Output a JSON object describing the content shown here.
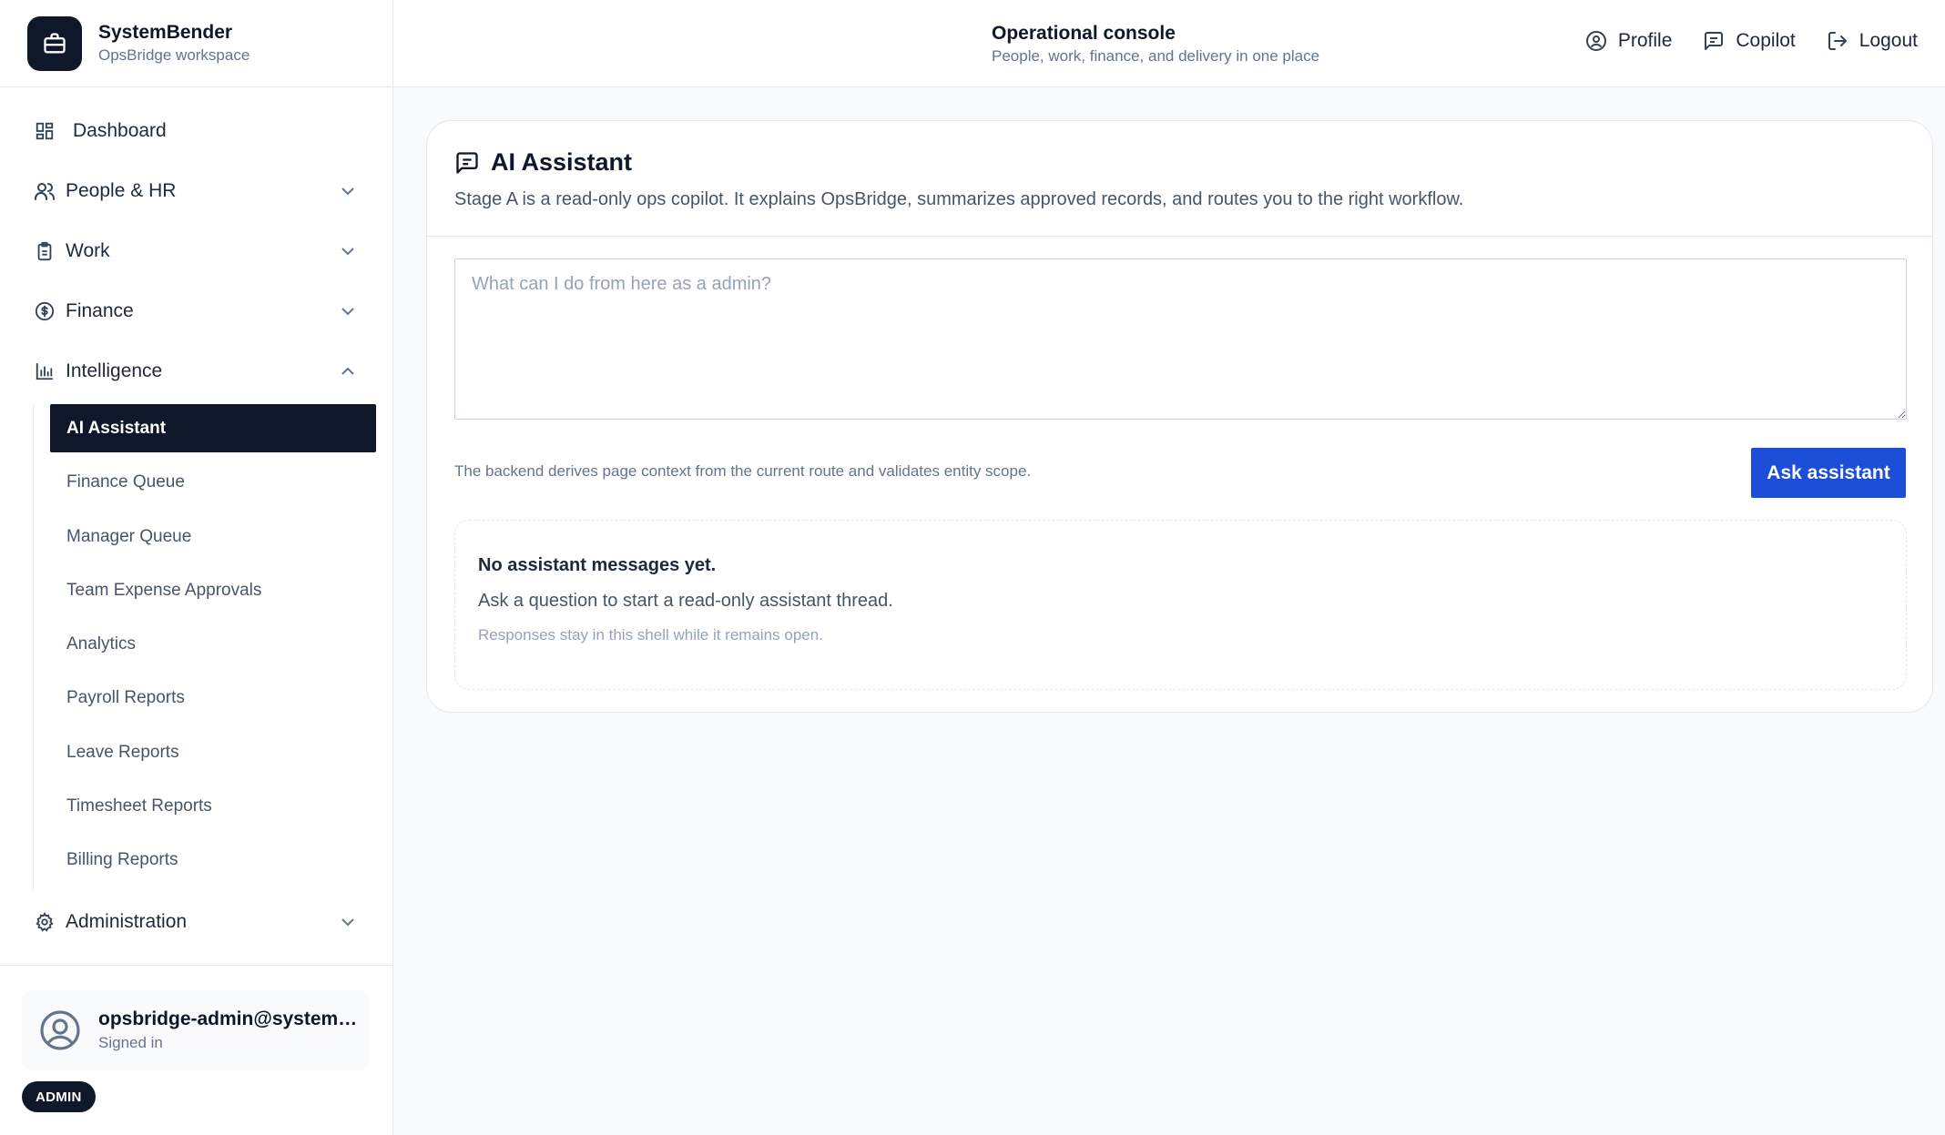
{
  "brand": {
    "name": "SystemBender",
    "workspace": "OpsBridge workspace"
  },
  "header": {
    "title": "Operational console",
    "subtitle": "People, work, finance, and delivery in one place",
    "actions": {
      "profile": "Profile",
      "copilot": "Copilot",
      "logout": "Logout"
    }
  },
  "sidebar": {
    "items": [
      {
        "label": "Dashboard",
        "icon": "grid-icon"
      },
      {
        "label": "People & HR",
        "icon": "users-icon",
        "expanded": false
      },
      {
        "label": "Work",
        "icon": "clipboard-icon",
        "expanded": false
      },
      {
        "label": "Finance",
        "icon": "dollar-circle-icon",
        "expanded": false
      },
      {
        "label": "Intelligence",
        "icon": "bar-chart-icon",
        "expanded": true
      },
      {
        "label": "Administration",
        "icon": "gear-icon",
        "expanded": false
      }
    ],
    "intelligence_items": [
      {
        "label": "AI Assistant",
        "active": true
      },
      {
        "label": "Finance Queue"
      },
      {
        "label": "Manager Queue"
      },
      {
        "label": "Team Expense Approvals"
      },
      {
        "label": "Analytics"
      },
      {
        "label": "Payroll Reports"
      },
      {
        "label": "Leave Reports"
      },
      {
        "label": "Timesheet Reports"
      },
      {
        "label": "Billing Reports"
      }
    ]
  },
  "user": {
    "email": "opsbridge-admin@systembender.com",
    "status": "Signed in",
    "role": "ADMIN"
  },
  "assistant": {
    "title": "AI Assistant",
    "description": "Stage A is a read-only ops copilot. It explains OpsBridge, summarizes approved records, and routes you to the right workflow.",
    "prompt_placeholder": "What can I do from here as a admin?",
    "prompt_value": "",
    "context_note": "The backend derives page context from the current route and validates entity scope.",
    "ask_label": "Ask assistant",
    "empty_title": "No assistant messages yet.",
    "empty_body": "Ask a question to start a read-only assistant thread.",
    "empty_note": "Responses stay in this shell while it remains open."
  },
  "colors": {
    "primary_dark": "#0f172a",
    "accent_blue": "#1d4ed8",
    "border": "#e2e8f0",
    "background": "#f8fafc"
  }
}
